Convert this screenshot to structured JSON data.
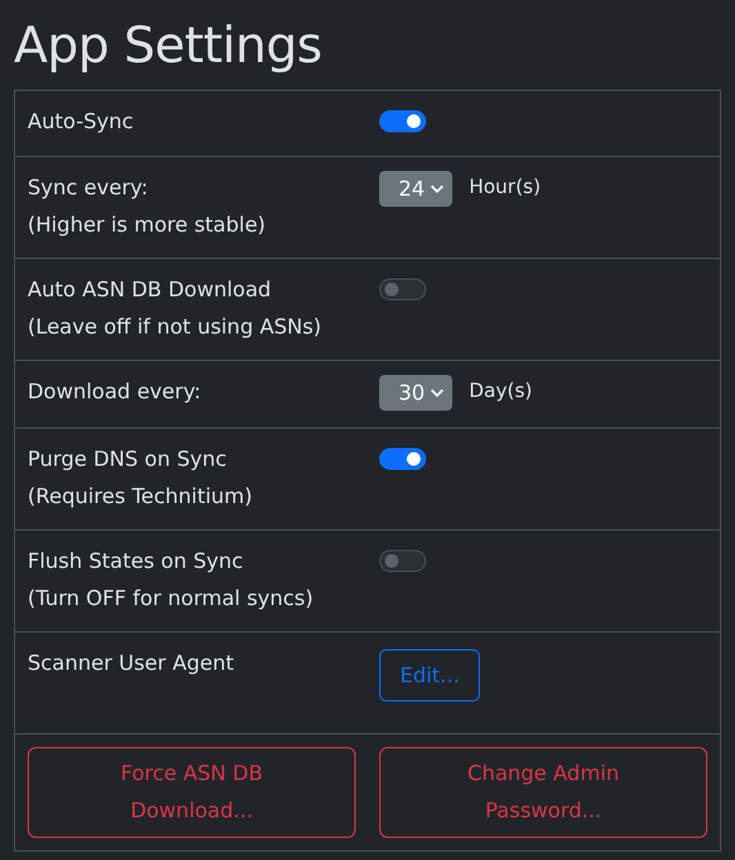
{
  "title": "App Settings",
  "settings": [
    {
      "kind": "toggle",
      "label": "Auto-Sync",
      "on": true
    },
    {
      "kind": "select",
      "label": "Sync every:",
      "note": "(Higher is more stable)",
      "value": "24",
      "unit": "Hour(s)"
    },
    {
      "kind": "toggle",
      "label": "Auto ASN DB Download",
      "note": "(Leave off if not using ASNs)",
      "on": false
    },
    {
      "kind": "select",
      "label": "Download every:",
      "value": "30",
      "unit": "Day(s)"
    },
    {
      "kind": "toggle",
      "label": "Purge DNS on Sync",
      "note": "(Requires Technitium)",
      "on": true
    },
    {
      "kind": "toggle",
      "label": "Flush States on Sync",
      "note": "(Turn OFF for normal syncs)",
      "on": false
    },
    {
      "kind": "button",
      "label": "Scanner User Agent",
      "button": "Edit..."
    }
  ],
  "actions": [
    "Force ASN DB Download...",
    "Change Admin Password..."
  ]
}
